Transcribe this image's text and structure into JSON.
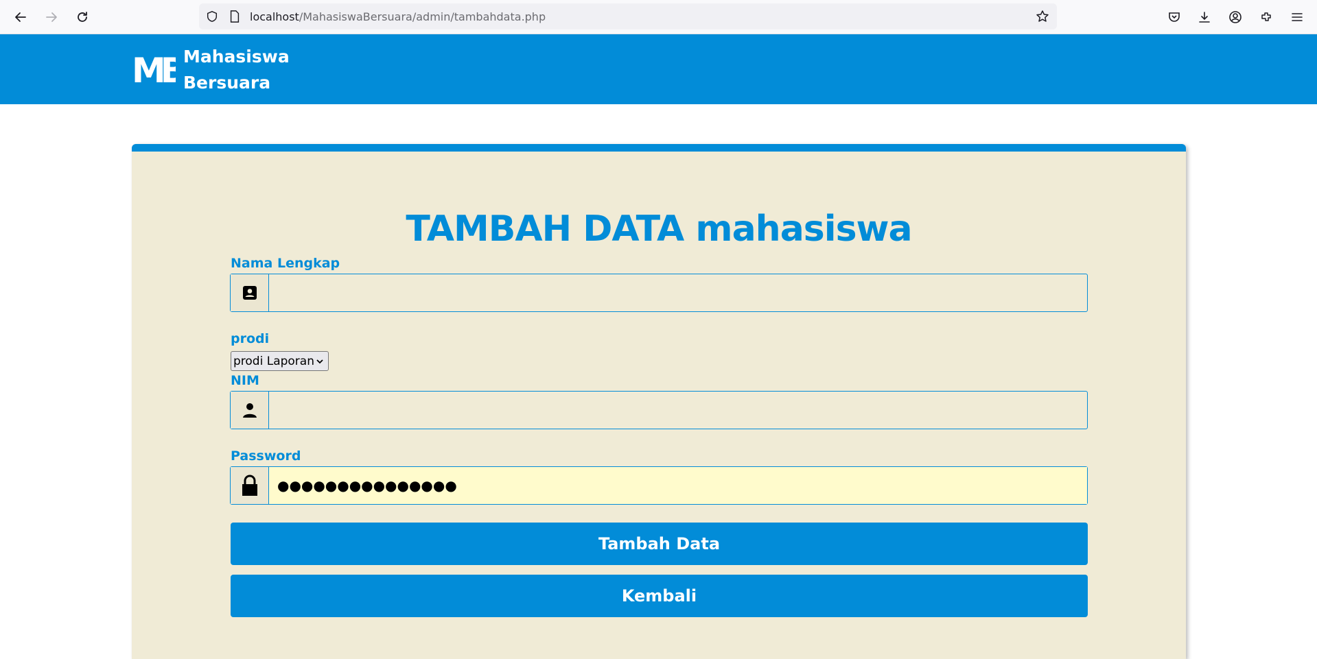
{
  "browser": {
    "url_host": "localhost",
    "url_path": "/MahasiswaBersuara/admin/tambahdata.php"
  },
  "header": {
    "logo_text": "MB",
    "brand_line1": "Mahasiswa",
    "brand_line2": "Bersuara"
  },
  "form": {
    "title": "TAMBAH DATA mahasiswa",
    "nama_label": "Nama Lengkap",
    "nama_value": "",
    "prodi_label": "prodi",
    "prodi_selected": "prodi Laporan",
    "nim_label": "NIM",
    "nim_value": "",
    "password_label": "Password",
    "password_value": "●●●●●●●●●●●●●●●",
    "submit_label": "Tambah Data",
    "back_label": "Kembali"
  },
  "colors": {
    "primary": "#028cd8",
    "card_background": "#f0ebd6",
    "autofill": "#fffbcc"
  },
  "icons": [
    "back-icon",
    "forward-icon",
    "reload-icon",
    "shield-icon",
    "page-icon",
    "star-icon",
    "pocket-icon",
    "download-icon",
    "account-icon",
    "extensions-icon",
    "menu-icon",
    "contact-card-icon",
    "user-icon",
    "lock-icon"
  ]
}
